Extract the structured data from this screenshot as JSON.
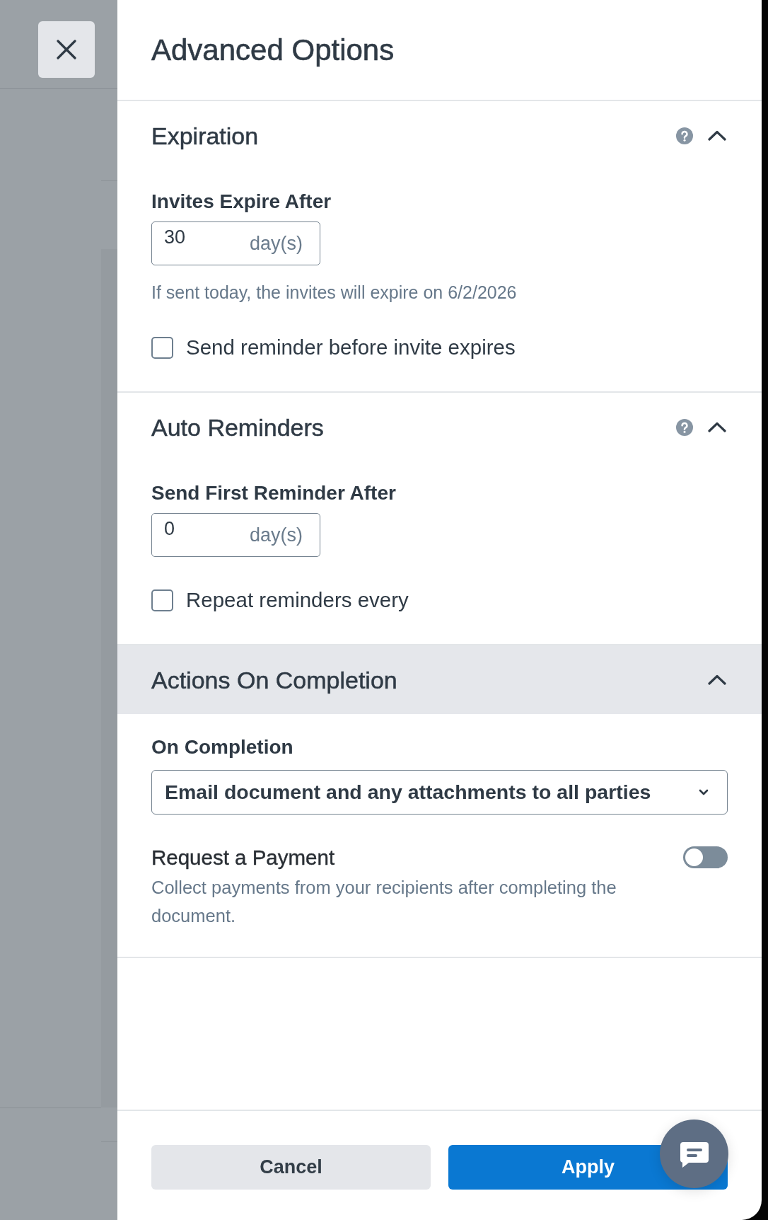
{
  "panel": {
    "title": "Advanced Options"
  },
  "sections": [
    {
      "title": "Expiration",
      "help": true,
      "expanded": true,
      "highlighted": false,
      "fields": [
        {
          "kind": "number",
          "label": "Invites Expire After",
          "value": "30",
          "unit": "day(s)"
        },
        {
          "kind": "hint",
          "text": "If sent today, the invites will expire on 6/2/2026"
        },
        {
          "kind": "checkbox",
          "label": "Send reminder before invite expires",
          "checked": false
        }
      ]
    },
    {
      "title": "Auto Reminders",
      "help": true,
      "expanded": true,
      "highlighted": false,
      "fields": [
        {
          "kind": "number",
          "label": "Send First Reminder After",
          "value": "0",
          "unit": "day(s)"
        },
        {
          "kind": "checkbox",
          "label": "Repeat reminders every",
          "checked": false
        }
      ]
    },
    {
      "title": "Actions On Completion",
      "help": false,
      "expanded": true,
      "highlighted": true,
      "fields": [
        {
          "kind": "select",
          "label": "On Completion",
          "value": "Email document and any attachments to all parties"
        },
        {
          "kind": "toggle",
          "label": "Request a Payment",
          "description": "Collect payments from your recipients after completing the document.",
          "on": false
        }
      ]
    }
  ],
  "footer": {
    "buttons": [
      {
        "label": "Cancel",
        "kind": "secondary"
      },
      {
        "label": "Apply",
        "kind": "primary"
      }
    ]
  }
}
